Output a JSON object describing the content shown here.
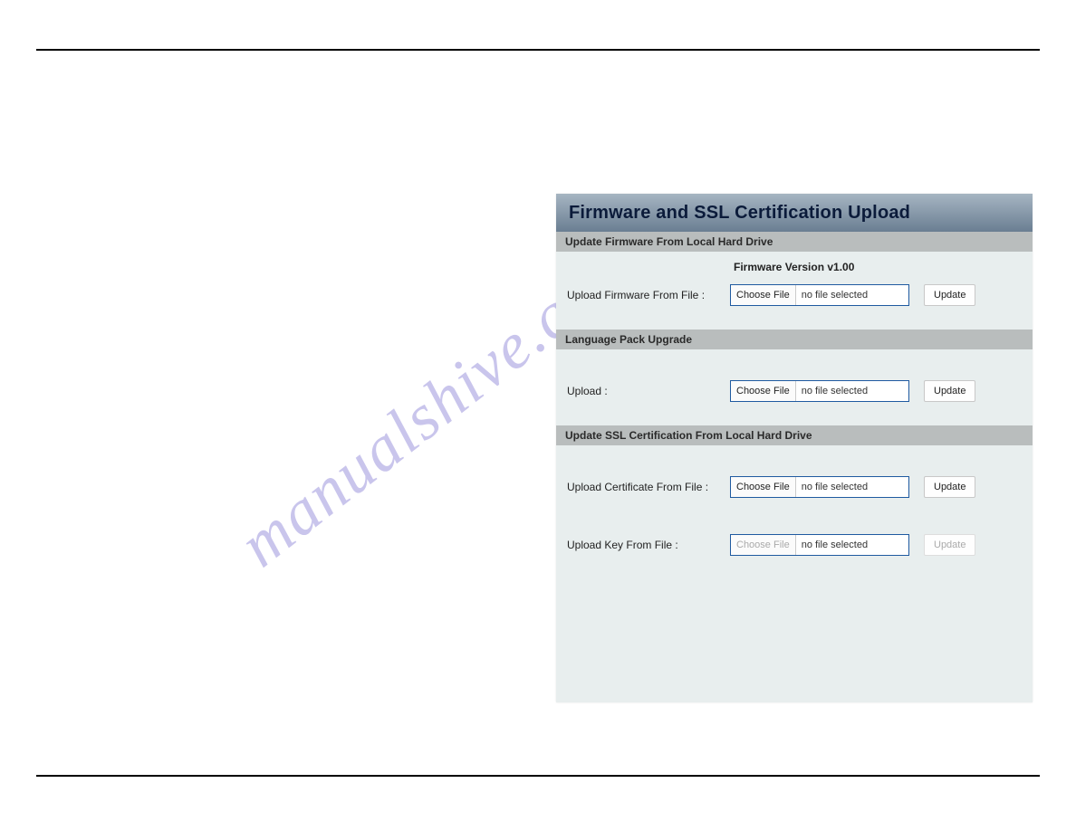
{
  "watermark": "manualshive.com",
  "panel": {
    "title": "Firmware and SSL Certification Upload",
    "sections": {
      "firmware": {
        "bar": "Update Firmware From Local Hard Drive",
        "version": "Firmware Version v1.00",
        "label": "Upload Firmware From File :",
        "choose": "Choose File",
        "nofile": "no file selected",
        "update": "Update"
      },
      "langpack": {
        "bar": "Language Pack Upgrade",
        "label": "Upload :",
        "choose": "Choose File",
        "nofile": "no file selected",
        "update": "Update"
      },
      "ssl": {
        "bar": "Update SSL Certification From Local Hard Drive",
        "cert_label": "Upload Certificate From File :",
        "cert_choose": "Choose File",
        "cert_nofile": "no file selected",
        "cert_update": "Update",
        "key_label": "Upload Key From File :",
        "key_choose": "Choose File",
        "key_nofile": "no file selected",
        "key_update": "Update"
      }
    }
  }
}
